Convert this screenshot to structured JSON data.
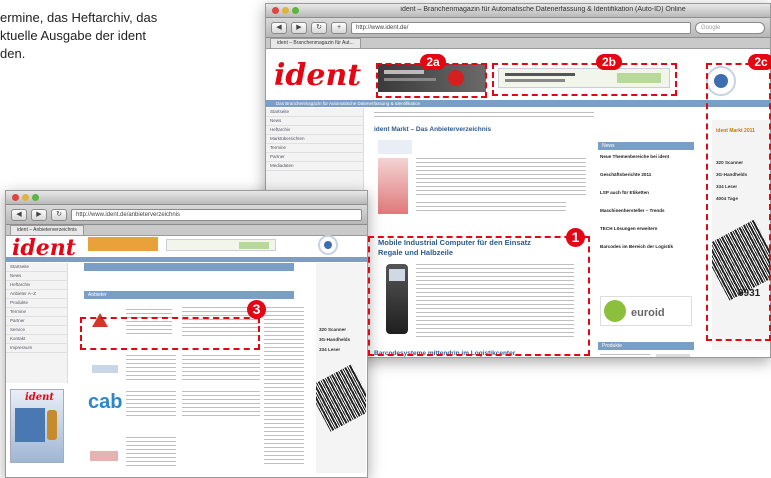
{
  "intro_text": "ermine, das Heftarchiv, das\nktuelle Ausgabe der ident\nden.",
  "back_window": {
    "title": "ident – Branchenmagazin für Automatische Datenerfassung & Identifikation (Auto-ID) Online",
    "url": "http://www.ident.de/",
    "search_placeholder": "Google",
    "tab_label": "ident – Branchenmagazin für Aut...",
    "logo": "ident",
    "banner_strip": "Das Branchenmagazin für Automatische Datenerfassung & Identifikation",
    "nav_items": [
      "Startseite",
      "News",
      "Heftarchiv",
      "Marktübersichten",
      "Termine",
      "Partner",
      "Mediadaten"
    ],
    "headline_main": "ident Markt – Das Anbieterverzeichnis",
    "headline_mobile": "Mobile Industrial Computer für den Einsatz",
    "headline_mobile_2": "Regale und Halbzeile",
    "headline_bottom": "Barcodesysteme mittendrin im Logistikcenter",
    "sidebox_head": "News",
    "news_items": [
      "Neue Themenbereiche bei ident",
      "Geschäftsberichte 2011",
      "LSP auch für Etiketten",
      "Maschinenhersteller – Trends",
      "TECH Lösungen erweitern",
      "Barcodes im Bereich der Logistik"
    ],
    "ad_euro_label": "euroid",
    "sidebox_head_2": "Produkte",
    "skyscraper_title": "ident Markt 2011",
    "skyscraper_lines": [
      "320 Scanner",
      "3G-Handhelds",
      "334 Leser",
      "4004 Tage"
    ],
    "skyscraper_number": "6931"
  },
  "front_window": {
    "url": "http://www.ident.de/anbieterverzeichnis",
    "tab_label": "ident – Anbieterverzeichnis",
    "logo": "ident",
    "nav_items": [
      "Startseite",
      "News",
      "Heftarchiv",
      "Anbieter A–Z",
      "Produkte",
      "Termine",
      "Partner",
      "Service",
      "Kontakt",
      "Impressum"
    ],
    "listing_head": "Anbieter",
    "company_label_cab": "cab",
    "magazine_logo": "ident",
    "side_lines": [
      "320 Scanner",
      "3G-Handhelds",
      "334 Leser"
    ]
  },
  "badges": {
    "b1": "1",
    "b2a": "2a",
    "b2b": "2b",
    "b2c": "2c",
    "b3": "3"
  },
  "colors": {
    "accent_red": "#e30613",
    "brand_blue": "#7a9fc7"
  }
}
